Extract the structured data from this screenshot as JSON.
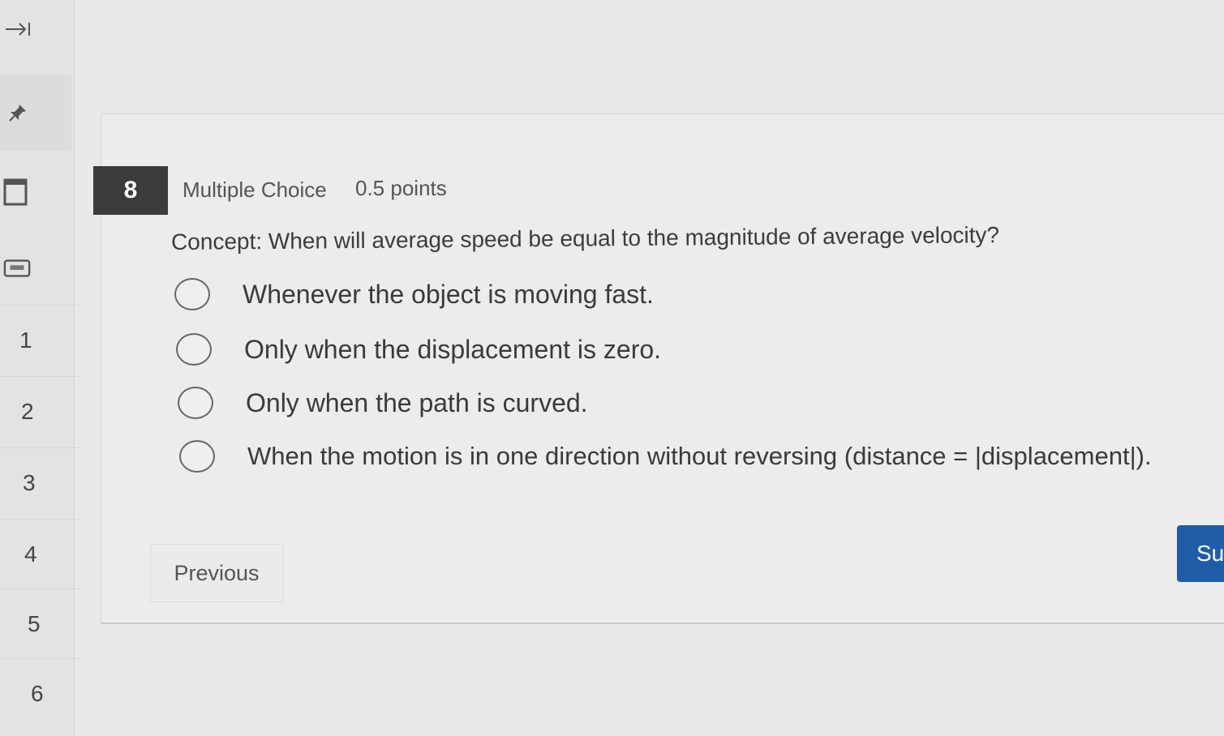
{
  "rail": {
    "collapse_icon": "arrow-to-right-icon",
    "pin_icon": "pin-icon",
    "icons": [
      "window-icon",
      "keyboard-icon"
    ],
    "question_numbers": [
      "1",
      "2",
      "3",
      "4",
      "5",
      "6"
    ]
  },
  "question": {
    "number": "8",
    "type": "Multiple Choice",
    "points": "0.5 points",
    "prompt": "Concept: When will average speed be equal to the magnitude of average velocity?",
    "options": [
      "Whenever the object is moving fast.",
      "Only when the displacement is zero.",
      "Only when the path is curved.",
      "When the motion is in one direction without reversing (distance = |displacement|)."
    ]
  },
  "nav": {
    "previous_label": "Previous",
    "submit_label": "Su"
  },
  "colors": {
    "accent": "#1f5da8",
    "question_badge": "#3b3b3b"
  }
}
